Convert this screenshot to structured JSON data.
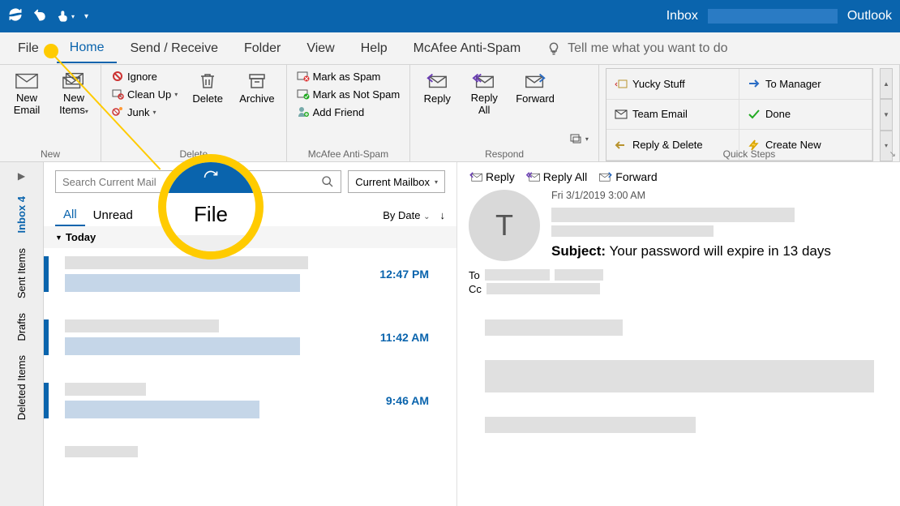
{
  "titlebar": {
    "label_inbox": "Inbox",
    "label_app": "Outlook"
  },
  "menubar": {
    "file": "File",
    "home": "Home",
    "sendreceive": "Send / Receive",
    "folder": "Folder",
    "view": "View",
    "help": "Help",
    "mcafee": "McAfee Anti-Spam",
    "tellme": "Tell me what you want to do"
  },
  "ribbon": {
    "new": {
      "new_email": "New\nEmail",
      "new_items": "New\nItems",
      "group": "New"
    },
    "delete": {
      "ignore": "Ignore",
      "cleanup": "Clean Up",
      "junk": "Junk",
      "delete": "Delete",
      "archive": "Archive",
      "group": "Delete"
    },
    "mcafee": {
      "mark_spam": "Mark as Spam",
      "mark_not_spam": "Mark as Not Spam",
      "add_friend": "Add Friend",
      "group": "McAfee Anti-Spam"
    },
    "respond": {
      "reply": "Reply",
      "reply_all": "Reply\nAll",
      "forward": "Forward",
      "group": "Respond"
    },
    "quicksteps": {
      "yucky": "Yucky Stuff",
      "manager": "To Manager",
      "team": "Team Email",
      "done": "Done",
      "replydel": "Reply & Delete",
      "createnew": "Create New",
      "group": "Quick Steps"
    }
  },
  "nav": {
    "inbox": "Inbox 4",
    "sent": "Sent Items",
    "drafts": "Drafts",
    "deleted": "Deleted Items"
  },
  "msglist": {
    "search_placeholder": "Search Current Mail",
    "scope": "Current Mailbox",
    "filter_all": "All",
    "filter_unread": "Unread",
    "sort": "By Date",
    "group_today": "Today",
    "times": [
      "12:47 PM",
      "11:42 AM",
      "9:46 AM"
    ]
  },
  "reading": {
    "reply": "Reply",
    "reply_all": "Reply All",
    "forward": "Forward",
    "date": "Fri 3/1/2019 3:00 AM",
    "avatar_initial": "T",
    "subject_label": "Subject:",
    "subject": "Your password will expire in 13 days",
    "to": "To",
    "cc": "Cc"
  },
  "callout": {
    "text": "File"
  }
}
